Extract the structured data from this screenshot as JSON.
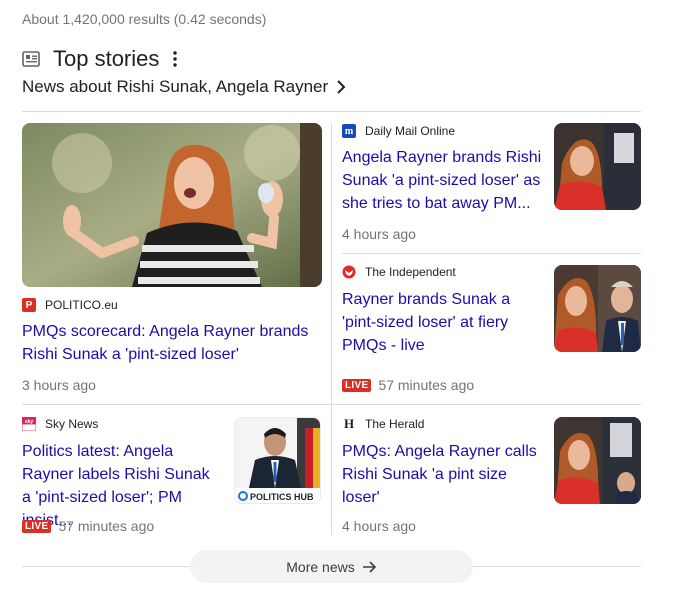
{
  "search": {
    "stats": "About 1,420,000 results (0.42 seconds)"
  },
  "top_stories": {
    "title": "Top stories",
    "subtitle": "News about Rishi Sunak, Angela Rayner",
    "more_label": "More news"
  },
  "stories": [
    {
      "source": "POLITICO.eu",
      "logo": "P",
      "logo_color": "#d93025",
      "headline": "PMQs scorecard: Angela Rayner brands Rishi Sunak a 'pint-sized loser'",
      "time": "3 hours ago",
      "live": ""
    },
    {
      "source": "Daily Mail Online",
      "logo": "m",
      "logo_color": "#1a4bb5",
      "headline": "Angela Rayner brands Rishi Sunak 'a pint-sized loser' as she tries to bat away PM...",
      "time": "4 hours ago",
      "live": ""
    },
    {
      "source": "The Independent",
      "logo": "🦅",
      "logo_color": "#e02b2b",
      "headline": "Rayner brands Sunak a 'pint-sized loser' at fiery PMQs - live",
      "time": "57 minutes ago",
      "live": "LIVE"
    },
    {
      "source": "Sky News",
      "logo": "sky",
      "logo_color": "#e0245e",
      "headline": "Politics latest: Angela Rayner labels Rishi Sunak a 'pint-sized loser'; PM insist...",
      "time": "57 minutes ago",
      "live": "LIVE",
      "thumb_caption": "POLITICS HUB"
    },
    {
      "source": "The Herald",
      "logo": "H",
      "logo_color": "#202124",
      "headline": "PMQs: Angela Rayner calls Rishi Sunak 'a pint size loser'",
      "time": "4 hours ago",
      "live": ""
    }
  ]
}
